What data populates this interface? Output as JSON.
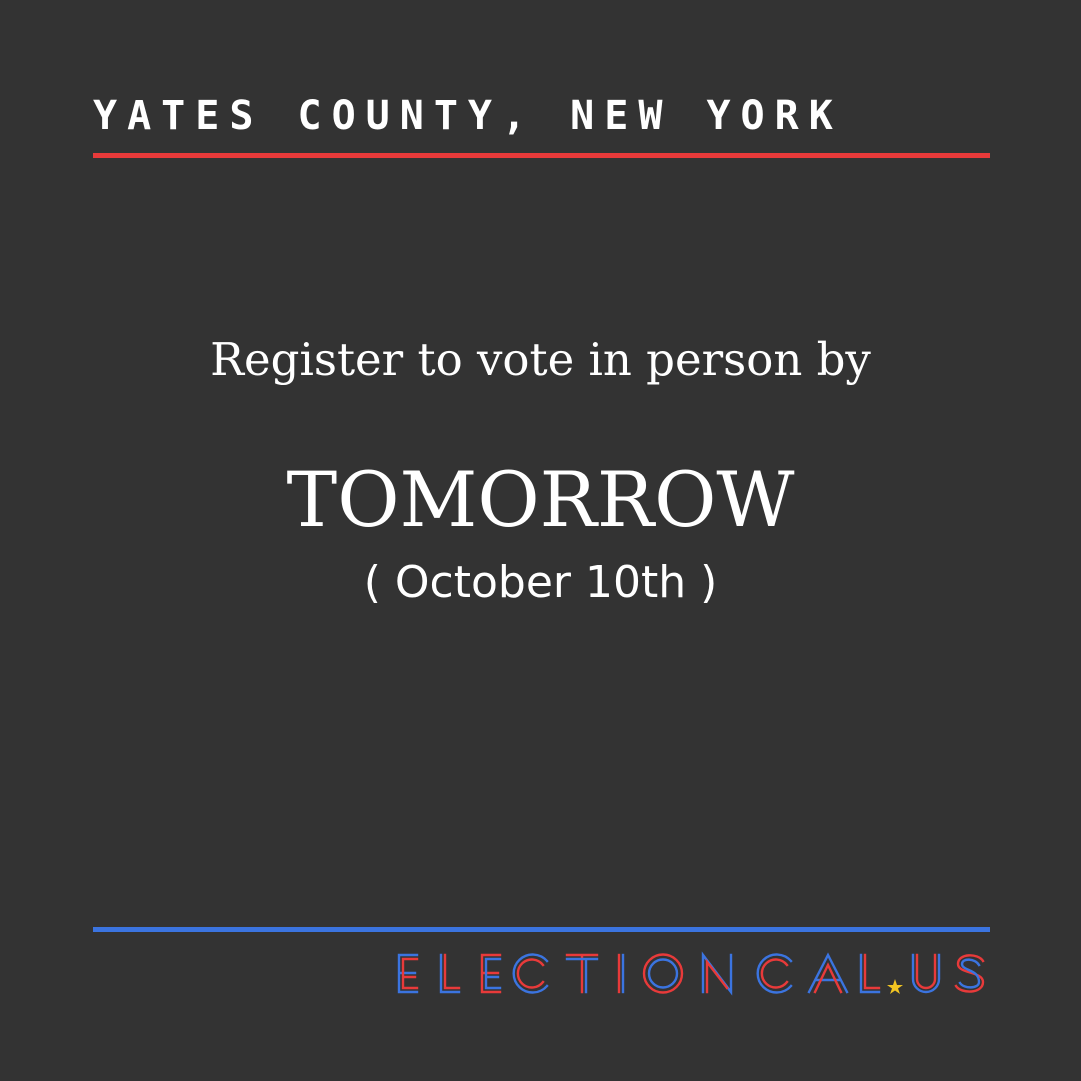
{
  "card": {
    "location": "YATES COUNTY, NEW YORK",
    "message": "Register to vote in person by",
    "deadline": "TOMORROW",
    "date": "( October 10th )"
  },
  "logo": {
    "text": "ELECTIONCAL.US",
    "icon": "star-icon",
    "letters": [
      "E",
      "L",
      "E",
      "C",
      "T",
      "I",
      "O",
      "N",
      "C",
      "A",
      "L",
      "U",
      "S"
    ]
  },
  "colors": {
    "background": "#333333",
    "text": "#ffffff",
    "red": "#e83a3a",
    "blue": "#3b74e0",
    "star": "#f2c522"
  }
}
